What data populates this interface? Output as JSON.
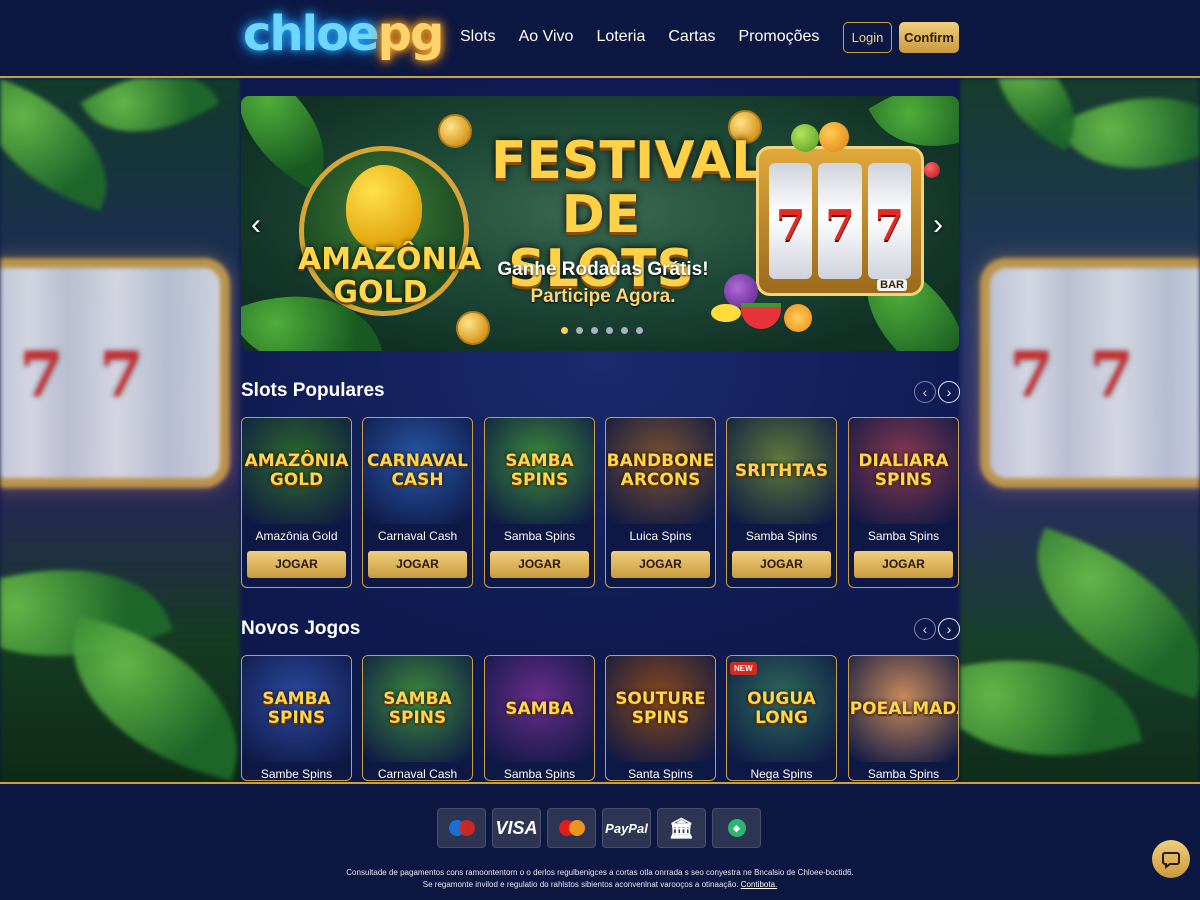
{
  "header": {
    "logo_part1": "chloe",
    "logo_part2": "pg",
    "nav": [
      "Slots",
      "Ao Vivo",
      "Loteria",
      "Cartas",
      "Promoções"
    ],
    "login_label": "Login",
    "confirm_label": "Confirm"
  },
  "banner": {
    "badge_text": "AMAZÔNIA GOLD",
    "title": "FESTIVAL DE SLOTS",
    "subtitle": "Ganhe Rodadas Grátis!",
    "cta": "Participe Agora.",
    "slot_symbols": [
      "7",
      "7",
      "7"
    ],
    "bar_label": "BAR",
    "dots_total": 6,
    "active_dot": 1
  },
  "popular": {
    "title": "Slots Populares",
    "prev_label": "‹",
    "next_label": "›",
    "games": [
      {
        "thumb_text": "AMAZÔNIA GOLD",
        "name": "Amazônia Gold",
        "button": "JOGAR",
        "bg": "#2f6b2a"
      },
      {
        "thumb_text": "CARNAVAL CASH",
        "name": "Carnaval Cash",
        "button": "JOGAR",
        "bg": "#2a58a8"
      },
      {
        "thumb_text": "SAMBA SPINS",
        "name": "Samba Spins",
        "button": "JOGAR",
        "bg": "#3d8a3a"
      },
      {
        "thumb_text": "BANDBONE ARCONS",
        "name": "Luica Spins",
        "button": "JOGAR",
        "bg": "#7a5230"
      },
      {
        "thumb_text": "SRITHTAS",
        "name": "Samba Spins",
        "button": "JOGAR",
        "bg": "#5f7a3a"
      },
      {
        "thumb_text": "DIALIARA SPINS",
        "name": "Samba Spins",
        "button": "JOGAR",
        "bg": "#8a3a50"
      }
    ]
  },
  "new_games": {
    "title": "Novos Jogos",
    "prev_label": "‹",
    "next_label": "›",
    "new_badge": "NEW",
    "games": [
      {
        "thumb_text": "SAMBA SPINS",
        "name": "Sambe Spins",
        "bg": "#2d4aa0"
      },
      {
        "thumb_text": "SAMBA SPINS",
        "name": "Carnaval Cash",
        "bg": "#3f8a3c"
      },
      {
        "thumb_text": "SAMBA",
        "name": "Samba Spins",
        "bg": "#6a2d8a"
      },
      {
        "thumb_text": "SOUTURE SPINS",
        "name": "Santa Spins",
        "bg": "#8a4a1c"
      },
      {
        "thumb_text": "OUGUA LONG",
        "name": "Nega Spins",
        "bg": "#2f6a5a"
      },
      {
        "thumb_text": "SPOEALMADA",
        "name": "Samba Spins",
        "bg": "#c98a5a"
      }
    ]
  },
  "footer": {
    "payments": [
      "maestro-icon",
      "VISA",
      "mastercard-icon",
      "PayPal",
      "bank-icon",
      "pix-icon"
    ],
    "visa_label": "VISA",
    "paypal_label": "PayPal",
    "legal_line1": "Consultade de pagamentos cons ramoontentorn o o derlos regulbenigces a cortas otla onrrada s seo conyestra ne Bncalsio de Chloee-boctid6.",
    "legal_line2": "Se regamonte invilod e regulatio do rahlstos sibientos aconvenlnat varooços a otinaação.",
    "legal_link": "Contibota."
  },
  "colors": {
    "gold": "#c9a04a",
    "navy": "#0c1742"
  }
}
